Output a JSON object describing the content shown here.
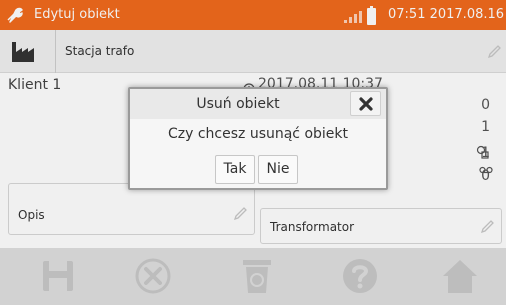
{
  "titlebar": {
    "title": "Edytuj obiekt",
    "clock": "07:51 2017.08.16",
    "app_icon": "wrench-icon",
    "accent_color": "#f26b1d"
  },
  "object": {
    "name": "Stacja trafo",
    "icon": "factory-icon"
  },
  "details": {
    "client": "Klient 1",
    "date": "2017.08.11 10:37",
    "counts": [
      "0",
      "1",
      "1",
      "0"
    ]
  },
  "subitems": {
    "opis": "Opis",
    "transformator": "Transformator"
  },
  "dialog": {
    "title": "Usuń obiekt",
    "message": "Czy chcesz usunąć obiekt",
    "yes_label": "Tak",
    "no_label": "Nie"
  },
  "toolbar": {
    "icons": [
      "save-icon",
      "cancel-icon",
      "trash-icon",
      "help-icon",
      "home-icon"
    ]
  }
}
